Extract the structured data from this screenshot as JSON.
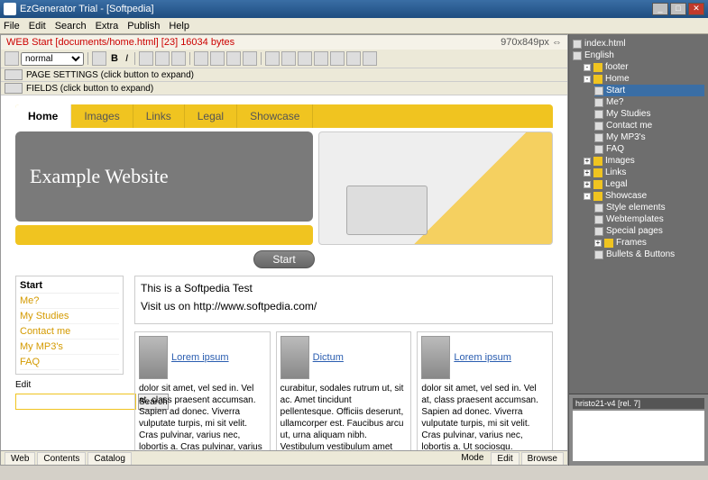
{
  "window": {
    "title": "EzGenerator Trial - [Softpedia]",
    "min": "_",
    "max": "□",
    "close": "✕"
  },
  "menu": {
    "file": "File",
    "edit": "Edit",
    "search": "Search",
    "extra": "Extra",
    "publish": "Publish",
    "help": "Help"
  },
  "infobar": {
    "path": "WEB Start [documents/home.html] [23] 16034 bytes",
    "dims": "970x849px ⇔"
  },
  "format_select": "normal",
  "collapsers": {
    "page": "PAGE SETTINGS (click button to expand)",
    "fields": "FIELDS (click button to expand)"
  },
  "tabs": {
    "home": "Home",
    "images": "Images",
    "links": "Links",
    "legal": "Legal",
    "showcase": "Showcase"
  },
  "hero": "Example Website",
  "start_btn": "Start",
  "sidemenu": {
    "hdr": "Start",
    "items": [
      "Me?",
      "My Studies",
      "Contact me",
      "My MP3's",
      "FAQ"
    ],
    "edit": "Edit",
    "search": "Search"
  },
  "intro": {
    "l1": "This is a Softpedia Test",
    "l2": "Visit us on http://www.softpedia.com/"
  },
  "cards": [
    {
      "title": "Lorem ipsum",
      "body": "dolor sit amet, vel sed in. Vel at, class praesent accumsan. Sapien ad donec. Viverra vulputate turpis, mi sit velit. Cras pulvinar, varius nec, lobortis a. Cras pulvinar, varius nec, lobortis a. Ut sociosqu."
    },
    {
      "title": "Dictum",
      "body": "curabitur, sodales rutrum ut, sit ac. Amet tincidunt pellentesque. Officiis deserunt, ullamcorper est. Faucibus arcu ut, urna aliquam nibh. Vestibulum vestibulum amet enim. Amet tincidunt pellentesque. Officiis"
    },
    {
      "title": "Lorem ipsum",
      "body": "dolor sit amet, vel sed in. Vel at, class praesent accumsan. Sapien ad donec. Viverra vulputate turpis, mi sit velit. Cras pulvinar, varius nec, lobortis a. Ut sociosqu."
    }
  ],
  "bottom": {
    "web": "Web",
    "contents": "Contents",
    "catalog": "Catalog",
    "mode": "Mode",
    "edit": "Edit",
    "browse": "Browse"
  },
  "tree": [
    {
      "l": 1,
      "t": "file",
      "label": "index.html"
    },
    {
      "l": 1,
      "t": "file",
      "label": "English"
    },
    {
      "l": 2,
      "t": "folder",
      "exp": "-",
      "label": "footer"
    },
    {
      "l": 2,
      "t": "folder",
      "exp": "-",
      "label": "Home"
    },
    {
      "l": 3,
      "t": "page",
      "label": "Start",
      "sel": true
    },
    {
      "l": 3,
      "t": "page",
      "label": "Me?"
    },
    {
      "l": 3,
      "t": "page",
      "label": "My Studies"
    },
    {
      "l": 3,
      "t": "page",
      "label": "Contact me"
    },
    {
      "l": 3,
      "t": "page",
      "label": "My MP3's"
    },
    {
      "l": 3,
      "t": "page",
      "label": "FAQ"
    },
    {
      "l": 2,
      "t": "folder",
      "exp": "+",
      "label": "Images"
    },
    {
      "l": 2,
      "t": "folder",
      "exp": "+",
      "label": "Links"
    },
    {
      "l": 2,
      "t": "folder",
      "exp": "+",
      "label": "Legal"
    },
    {
      "l": 2,
      "t": "folder",
      "exp": "-",
      "label": "Showcase"
    },
    {
      "l": 3,
      "t": "page",
      "label": "Style elements"
    },
    {
      "l": 3,
      "t": "page",
      "label": "Webtemplates"
    },
    {
      "l": 3,
      "t": "page",
      "label": "Special pages"
    },
    {
      "l": 3,
      "t": "folder",
      "exp": "+",
      "label": "Frames"
    },
    {
      "l": 3,
      "t": "page",
      "label": "Bullets & Buttons"
    }
  ],
  "preview": {
    "title": "hristo21-v4 [rel. 7]"
  }
}
